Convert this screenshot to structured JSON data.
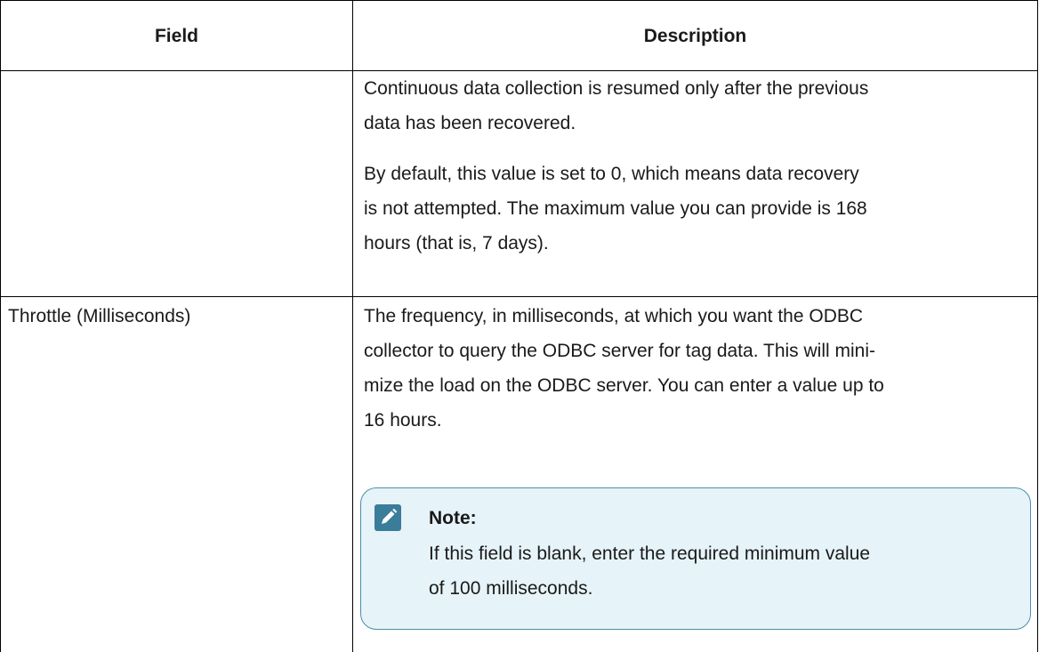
{
  "table": {
    "headers": {
      "field": "Field",
      "description": "Description"
    },
    "rows": [
      {
        "field": "",
        "paragraphs": [
          [
            "Continuous data collection is resumed only after the previous",
            "data has been recovered."
          ],
          [
            "By default, this value is set to 0, which means data recovery",
            "is not attempted. The maximum value you can provide is 168",
            "hours (that is, 7 days)."
          ]
        ]
      },
      {
        "field": "Throttle (Milliseconds)",
        "paragraphs": [
          [
            "The frequency, in milliseconds, at which you want the ODBC",
            "collector to query the ODBC server for tag data. This will mini-",
            "mize the load on the ODBC server. You can enter a value up to",
            "16 hours."
          ]
        ],
        "note": {
          "icon": "pencil-icon",
          "title": "Note:",
          "lines": [
            "If this field is blank, enter the required minimum value",
            "of 100 milliseconds."
          ]
        }
      }
    ]
  },
  "colors": {
    "border": "#000000",
    "note_background": "#e6f3f8",
    "note_border": "#4f8ea8",
    "note_icon": "#3a7d9a"
  }
}
